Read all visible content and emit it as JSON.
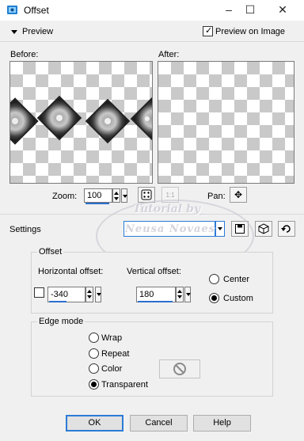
{
  "window": {
    "title": "Offset",
    "minimize_glyph": "–",
    "maximize_glyph": "☐",
    "close_glyph": "✕"
  },
  "preview": {
    "section_label": "Preview",
    "preview_on_image_label": "Preview on Image",
    "preview_on_image_checked": true,
    "before_label": "Before:",
    "after_label": "After:",
    "zoom_label": "Zoom:",
    "zoom_value": "100",
    "pan_label": "Pan:",
    "zoom_fit_icon": "dice-icon",
    "actual_size_icon_text": "1:1"
  },
  "settings": {
    "label": "Settings",
    "preset_value": ""
  },
  "offset": {
    "group_label": "Offset",
    "horizontal_label": "Horizontal offset:",
    "horizontal_value": "-340",
    "vertical_label": "Vertical offset:",
    "vertical_value": "180",
    "link_checked": false,
    "center_label": "Center",
    "custom_label": "Custom",
    "selected": "Custom"
  },
  "edge_mode": {
    "group_label": "Edge mode",
    "options": [
      "Wrap",
      "Repeat",
      "Color",
      "Transparent"
    ],
    "selected": "Transparent"
  },
  "buttons": {
    "ok": "OK",
    "cancel": "Cancel",
    "help": "Help"
  },
  "watermark": {
    "line1": "Tutorial by_",
    "line2": "Neusa Novaes"
  },
  "colors": {
    "accent": "#2b7bd6",
    "checker_dark": "#c9c9c9",
    "window_bg": "#f0f0f0"
  }
}
